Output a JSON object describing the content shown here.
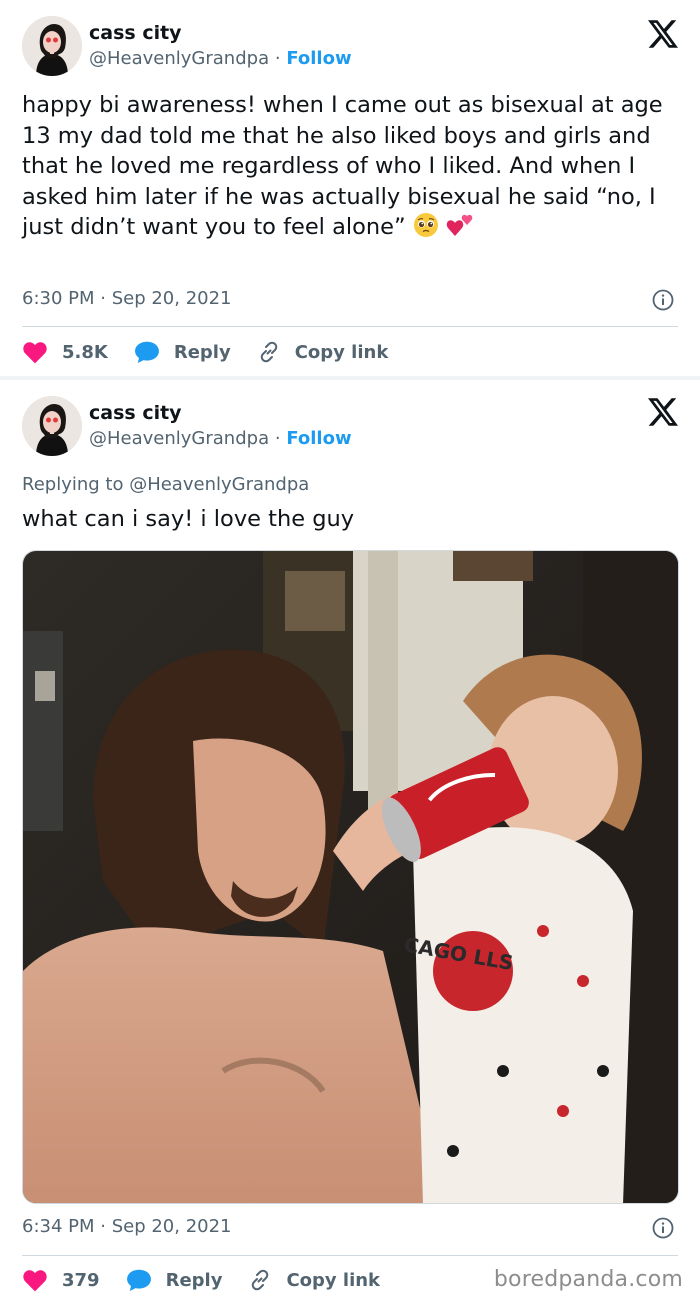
{
  "tweet1": {
    "display_name": "cass city",
    "handle": "@HeavenlyGrandpa",
    "separator": "·",
    "follow_label": "Follow",
    "text": "happy bi awareness! when I came out as bisexual at age 13 my dad told me that he also liked boys and girls and that he loved me regardless of who I liked. And when I asked him later if he was actually bisexual he said “no, I just didn’t want you to feel alone”",
    "timestamp": "6:30 PM · Sep 20, 2021",
    "like_count": "5.8K",
    "reply_label": "Reply",
    "copy_link_label": "Copy link",
    "emojis": [
      "pleading-face-emoji",
      "two-hearts-emoji"
    ]
  },
  "tweet2": {
    "display_name": "cass city",
    "handle": "@HeavenlyGrandpa",
    "separator": "·",
    "follow_label": "Follow",
    "replying_to": "Replying to @HeavenlyGrandpa",
    "text": "what can i say! i love the guy",
    "photo_shirt_text": "CAGO LLS",
    "timestamp": "6:34 PM · Sep 20, 2021",
    "like_count": "379",
    "reply_label": "Reply",
    "copy_link_label": "Copy link"
  },
  "watermark": "boredpanda.com",
  "colors": {
    "text": "#0f1419",
    "muted": "#536471",
    "link": "#1d9bf0",
    "like": "#f91880",
    "divider": "#cfd9de"
  },
  "icons": [
    "x-logo-icon",
    "info-icon",
    "heart-icon",
    "reply-bubble-icon",
    "link-icon"
  ]
}
